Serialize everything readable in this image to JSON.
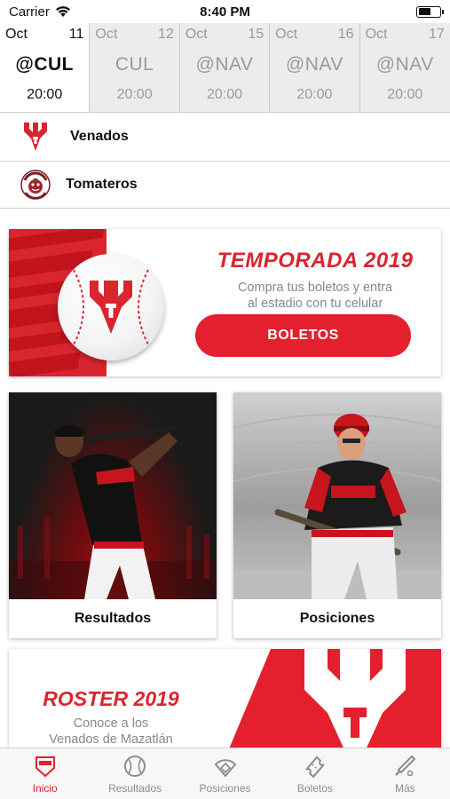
{
  "status_bar": {
    "carrier": "Carrier",
    "time": "8:40 PM"
  },
  "schedule": [
    {
      "month": "Oct",
      "day": "11",
      "opponent": "@CUL",
      "time": "20:00",
      "active": true
    },
    {
      "month": "Oct",
      "day": "12",
      "opponent": "CUL",
      "time": "20:00",
      "active": false
    },
    {
      "month": "Oct",
      "day": "15",
      "opponent": "@NAV",
      "time": "20:00",
      "active": false
    },
    {
      "month": "Oct",
      "day": "16",
      "opponent": "@NAV",
      "time": "20:00",
      "active": false
    },
    {
      "month": "Oct",
      "day": "17",
      "opponent": "@NAV",
      "time": "20:00",
      "active": false
    }
  ],
  "teams": [
    {
      "name": "Venados",
      "logo": "venados-logo"
    },
    {
      "name": "Tomateros",
      "logo": "tomateros-logo"
    }
  ],
  "promo": {
    "title": "TEMPORADA 2019",
    "subtitle_line1": "Compra tus boletos y entra",
    "subtitle_line2": "al estadio con tu celular",
    "button_label": "BOLETOS",
    "accent_color": "#e4202e"
  },
  "cards": [
    {
      "caption": "Resultados",
      "image": "player-batting-photo"
    },
    {
      "caption": "Posiciones",
      "image": "player-in-uniform-photo"
    }
  ],
  "roster": {
    "title": "ROSTER 2019",
    "subtitle_line1": "Conoce a los",
    "subtitle_line2": "Venados de Mazatlán"
  },
  "tabbar": [
    {
      "label": "Inicio",
      "icon": "home-base-icon",
      "active": true
    },
    {
      "label": "Resultados",
      "icon": "baseball-icon",
      "active": false
    },
    {
      "label": "Posiciones",
      "icon": "field-icon",
      "active": false
    },
    {
      "label": "Boletos",
      "icon": "ticket-icon",
      "active": false
    },
    {
      "label": "Más",
      "icon": "bat-icon",
      "active": false
    }
  ]
}
